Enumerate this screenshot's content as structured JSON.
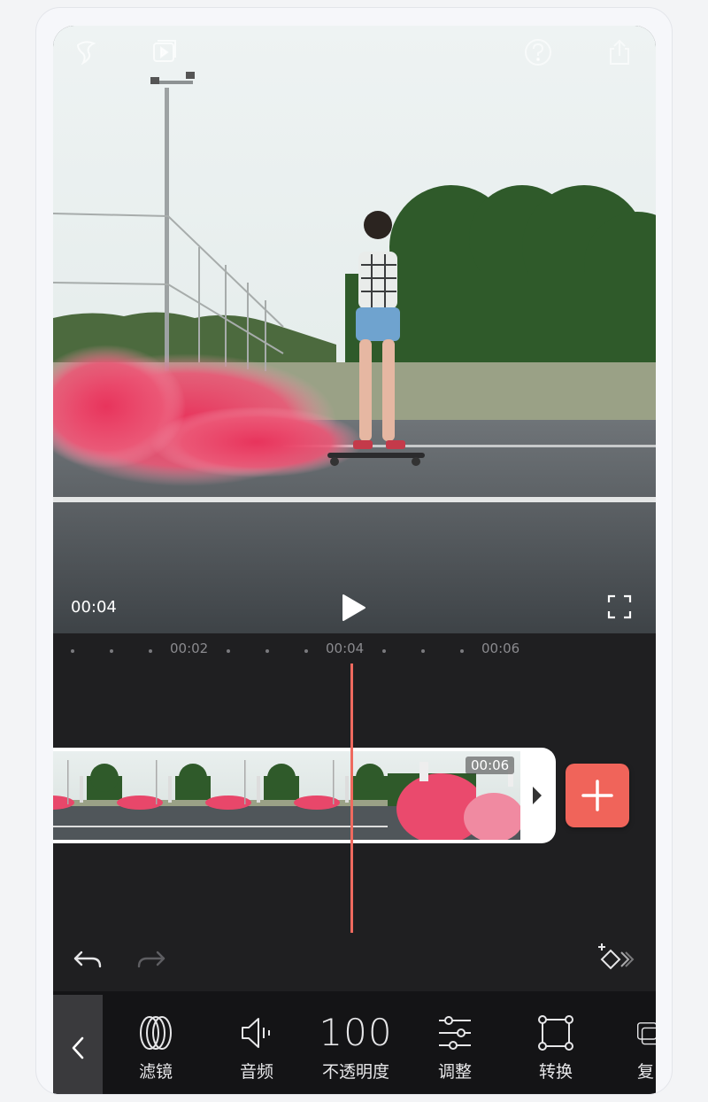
{
  "preview": {
    "current_time": "00:04",
    "icons": [
      "logo-icon",
      "tutorial-icon",
      "help-icon",
      "share-icon",
      "play-icon",
      "fullscreen-icon"
    ]
  },
  "timeline": {
    "ticks": [
      "00:02",
      "00:04",
      "00:06"
    ],
    "clip_duration": "00:06",
    "accent_color": "#f0645a"
  },
  "toolbar": {
    "items": [
      {
        "label": "滤镜",
        "icon": "filter-icon"
      },
      {
        "label": "音频",
        "icon": "volume-icon"
      },
      {
        "label": "不透明度",
        "value": "100"
      },
      {
        "label": "调整",
        "icon": "sliders-icon"
      },
      {
        "label": "转换",
        "icon": "transform-icon"
      },
      {
        "label": "复",
        "icon": "copy-icon"
      }
    ]
  }
}
